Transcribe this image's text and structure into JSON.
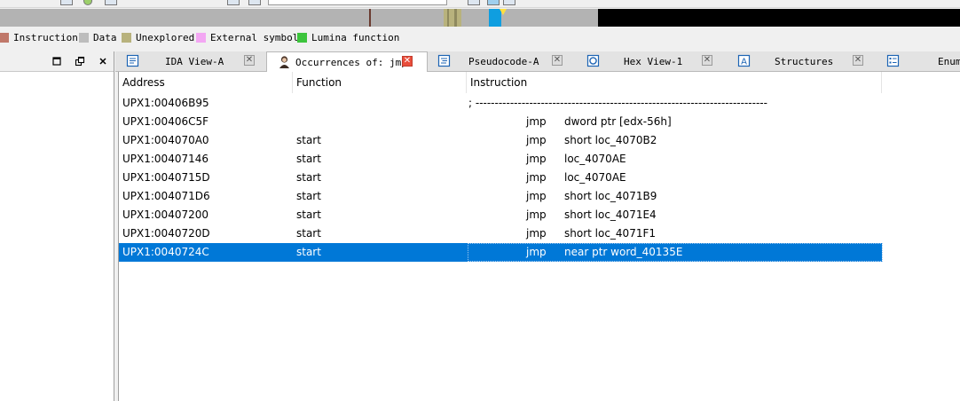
{
  "nav_colors": {
    "grey": "#b3b3b3",
    "code_brown": "#c0786a",
    "unexplored": "#b8b27d",
    "current_blue": "#0f9ee0",
    "black": "#000000",
    "pointer": "#ffe040"
  },
  "legend": [
    {
      "label": "Instruction",
      "color": "#c0786a"
    },
    {
      "label": "Data",
      "color": "#bdbdbd"
    },
    {
      "label": "Unexplored",
      "color": "#b8b27d"
    },
    {
      "label": "External symbol",
      "color": "#f3a7f3"
    },
    {
      "label": "Lumina function",
      "color": "#3cc43c"
    }
  ],
  "tabs": [
    {
      "label": "IDA View-A",
      "icon": "ida-view-icon",
      "active": false
    },
    {
      "label": "Occurrences of: jmp",
      "icon": "occurrences-avatar-icon",
      "active": true
    },
    {
      "label": "Pseudocode-A",
      "icon": "pseudocode-icon",
      "active": false
    },
    {
      "label": "Hex View-1",
      "icon": "hex-view-icon",
      "active": false
    },
    {
      "label": "Structures",
      "icon": "structures-icon",
      "active": false
    },
    {
      "label": "Enum",
      "icon": "enums-icon",
      "active": false
    }
  ],
  "columns": {
    "address": "Address",
    "function": "Function",
    "instruction": "Instruction"
  },
  "rows": [
    {
      "address": "UPX1:00406B95",
      "function": "",
      "mnemonic": "",
      "operand": "",
      "comment": "; ----------------------------------------------------------------------------"
    },
    {
      "address": "UPX1:00406C5F",
      "function": "",
      "mnemonic": "jmp",
      "operand": "dword ptr [edx-56h]",
      "comment": ""
    },
    {
      "address": "UPX1:004070A0",
      "function": "start",
      "mnemonic": "jmp",
      "operand": "short loc_4070B2",
      "comment": ""
    },
    {
      "address": "UPX1:00407146",
      "function": "start",
      "mnemonic": "jmp",
      "operand": "loc_4070AE",
      "comment": ""
    },
    {
      "address": "UPX1:0040715D",
      "function": "start",
      "mnemonic": "jmp",
      "operand": "loc_4070AE",
      "comment": ""
    },
    {
      "address": "UPX1:004071D6",
      "function": "start",
      "mnemonic": "jmp",
      "operand": "short loc_4071B9",
      "comment": ""
    },
    {
      "address": "UPX1:00407200",
      "function": "start",
      "mnemonic": "jmp",
      "operand": "short loc_4071E4",
      "comment": ""
    },
    {
      "address": "UPX1:0040720D",
      "function": "start",
      "mnemonic": "jmp",
      "operand": "short loc_4071F1",
      "comment": ""
    },
    {
      "address": "UPX1:0040724C",
      "function": "start",
      "mnemonic": "jmp",
      "operand": "near ptr word_40135E",
      "comment": "",
      "selected": true
    }
  ],
  "left_pane": {
    "buttons": [
      "restore-icon",
      "float-icon",
      "close-icon"
    ]
  },
  "selection_color": "#0078d7"
}
